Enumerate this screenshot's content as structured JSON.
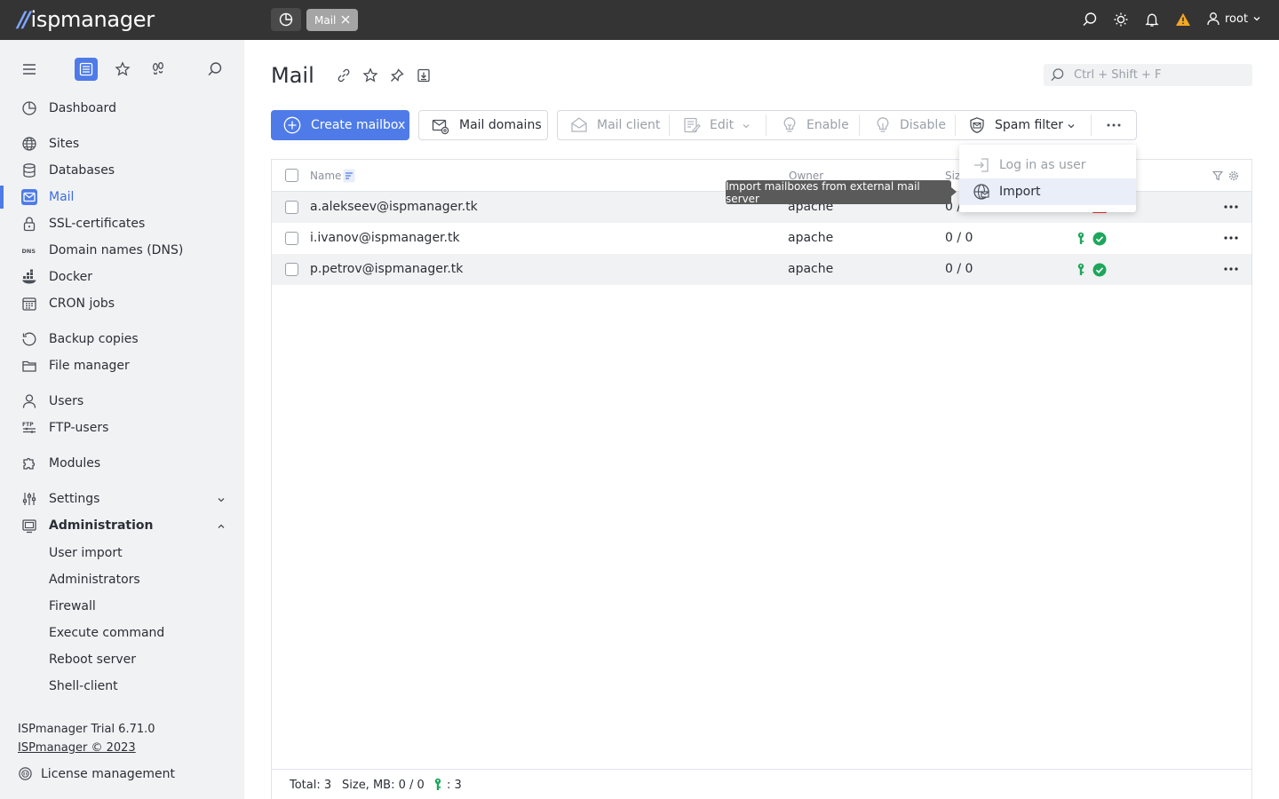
{
  "app": {
    "logo_mark": "//",
    "logo_text": "ispmanager"
  },
  "topbar": {
    "tab_label": "Mail",
    "user_name": "root",
    "warning_color": "#f5a623"
  },
  "sidebar": {
    "items": [
      {
        "label": "Dashboard",
        "icon": "dashboard-icon"
      },
      {
        "label": "Sites",
        "icon": "globe-icon"
      },
      {
        "label": "Databases",
        "icon": "database-icon"
      },
      {
        "label": "Mail",
        "icon": "mail-icon"
      },
      {
        "label": "SSL-certificates",
        "icon": "lock-icon"
      },
      {
        "label": "Domain names (DNS)",
        "icon": "dns-icon"
      },
      {
        "label": "Docker",
        "icon": "docker-icon"
      },
      {
        "label": "CRON jobs",
        "icon": "calendar-icon"
      },
      {
        "label": "Backup copies",
        "icon": "backup-icon"
      },
      {
        "label": "File manager",
        "icon": "folder-icon"
      },
      {
        "label": "Users",
        "icon": "user-icon"
      },
      {
        "label": "FTP-users",
        "icon": "ftp-icon"
      },
      {
        "label": "Modules",
        "icon": "puzzle-icon"
      },
      {
        "label": "Settings",
        "icon": "sliders-icon"
      },
      {
        "label": "Administration",
        "icon": "admin-icon"
      }
    ],
    "admin_sub": [
      "User import",
      "Administrators",
      "Firewall",
      "Execute command",
      "Reboot server",
      "Shell-client"
    ],
    "version": "ISPmanager Trial 6.71.0",
    "copyright": "ISPmanager © 2023",
    "license": "License management"
  },
  "page": {
    "title": "Mail",
    "search_placeholder": "Ctrl + Shift + F"
  },
  "toolbar": {
    "create": "Create mailbox",
    "domains": "Mail domains",
    "client": "Mail client",
    "edit": "Edit",
    "enable": "Enable",
    "disable": "Disable",
    "spam": "Spam filter"
  },
  "dropdown": {
    "login": "Log in as user",
    "import": "Import"
  },
  "tooltip": "Import mailboxes from external mail server",
  "table": {
    "headers": {
      "name": "Name",
      "owner": "Owner",
      "size": "Siz"
    },
    "rows": [
      {
        "name": "a.alekseev@ispmanager.tk",
        "owner": "apache",
        "size": "0 /"
      },
      {
        "name": "i.ivanov@ispmanager.tk",
        "owner": "apache",
        "size": "0 / 0"
      },
      {
        "name": "p.petrov@ispmanager.tk",
        "owner": "apache",
        "size": "0 / 0"
      }
    ],
    "footer": {
      "total": "Total: 3",
      "size": "Size, MB: 0 / 0",
      "count": ": 3"
    }
  },
  "colors": {
    "accent": "#4e7be8",
    "ok_green": "#1ea65c",
    "error_red": "#e03030"
  }
}
